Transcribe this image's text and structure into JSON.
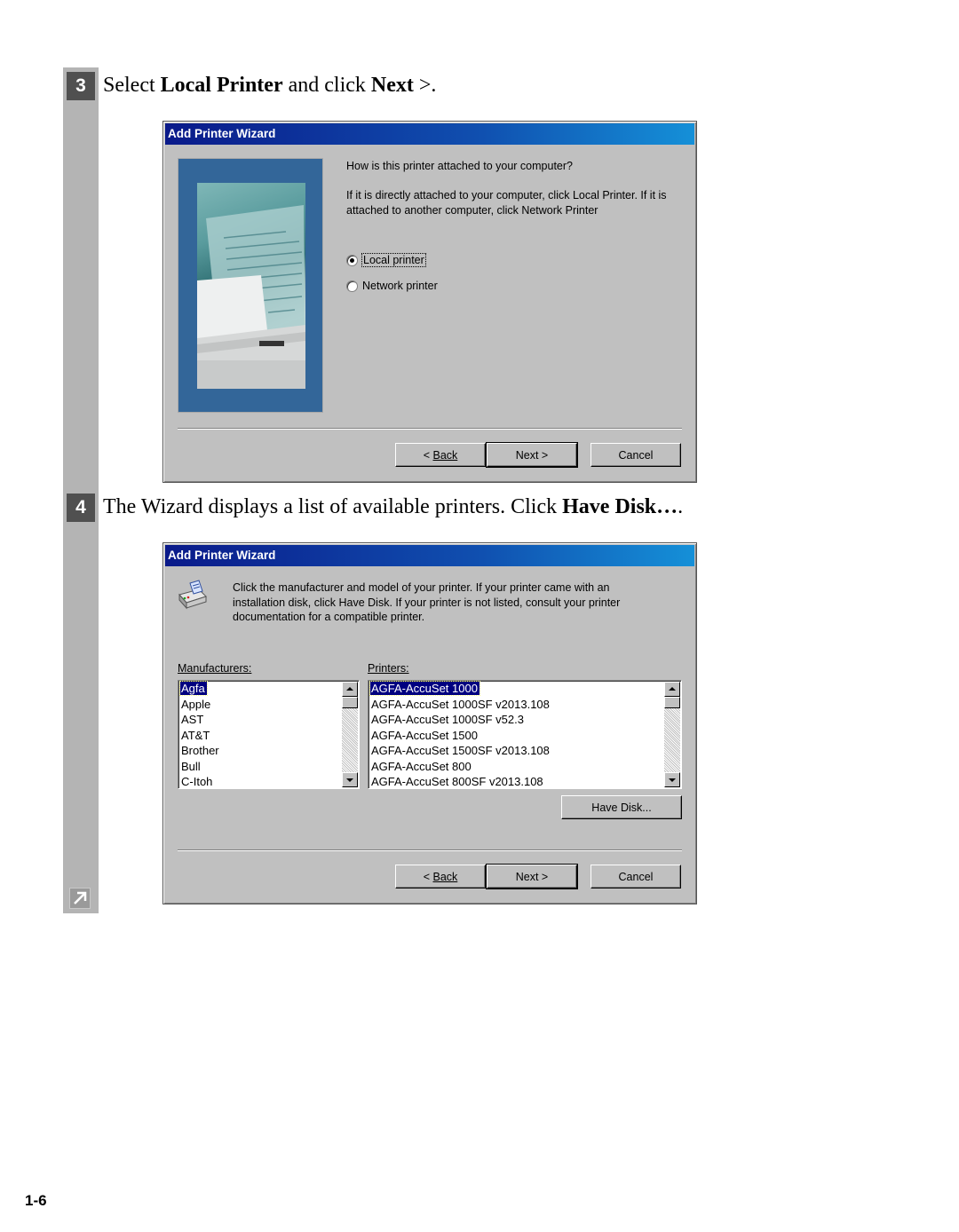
{
  "steps": [
    {
      "number": "3",
      "text_parts": [
        "Select ",
        "Local Printer",
        " and click ",
        "Next",
        " >."
      ]
    },
    {
      "number": "4",
      "text_parts": [
        "The Wizard displays a list of available printers. Click ",
        "Have Disk…",
        "."
      ]
    }
  ],
  "dialog1": {
    "title": "Add Printer Wizard",
    "question": "How is this printer attached to your computer?",
    "instructions": "If it is directly attached to your computer, click Local Printer. If it is attached to another computer, click Network Printer",
    "options": [
      {
        "label": "Local printer",
        "checked": true
      },
      {
        "label": "Network printer",
        "checked": false
      }
    ],
    "image_icon": "printer-photo-image",
    "buttons": {
      "back": "Back",
      "back_prefix": "< ",
      "next": "Next >",
      "cancel": "Cancel"
    }
  },
  "dialog2": {
    "title": "Add Printer Wizard",
    "icon": "printer-icon",
    "instructions": "Click the manufacturer and model of your printer. If your printer came with an installation disk, click Have Disk. If your printer is not listed, consult your printer documentation for a compatible printer.",
    "manufacturers_label": "Manufacturers:",
    "manufacturers": [
      "Agfa",
      "Apple",
      "AST",
      "AT&T",
      "Brother",
      "Bull",
      "C-Itoh"
    ],
    "selected_manufacturer": "Agfa",
    "printers_label": "Printers:",
    "printers": [
      "AGFA-AccuSet 1000",
      "AGFA-AccuSet 1000SF v2013.108",
      "AGFA-AccuSet 1000SF v52.3",
      "AGFA-AccuSet 1500",
      "AGFA-AccuSet 1500SF v2013.108",
      "AGFA-AccuSet 800",
      "AGFA-AccuSet 800SF v2013.108"
    ],
    "selected_printer": "AGFA-AccuSet 1000",
    "have_disk": "Have Disk...",
    "buttons": {
      "back": "Back",
      "back_prefix": "< ",
      "next": "Next >",
      "cancel": "Cancel"
    }
  },
  "continue_icon": "arrow-up-right-icon",
  "page_number": "1-6"
}
